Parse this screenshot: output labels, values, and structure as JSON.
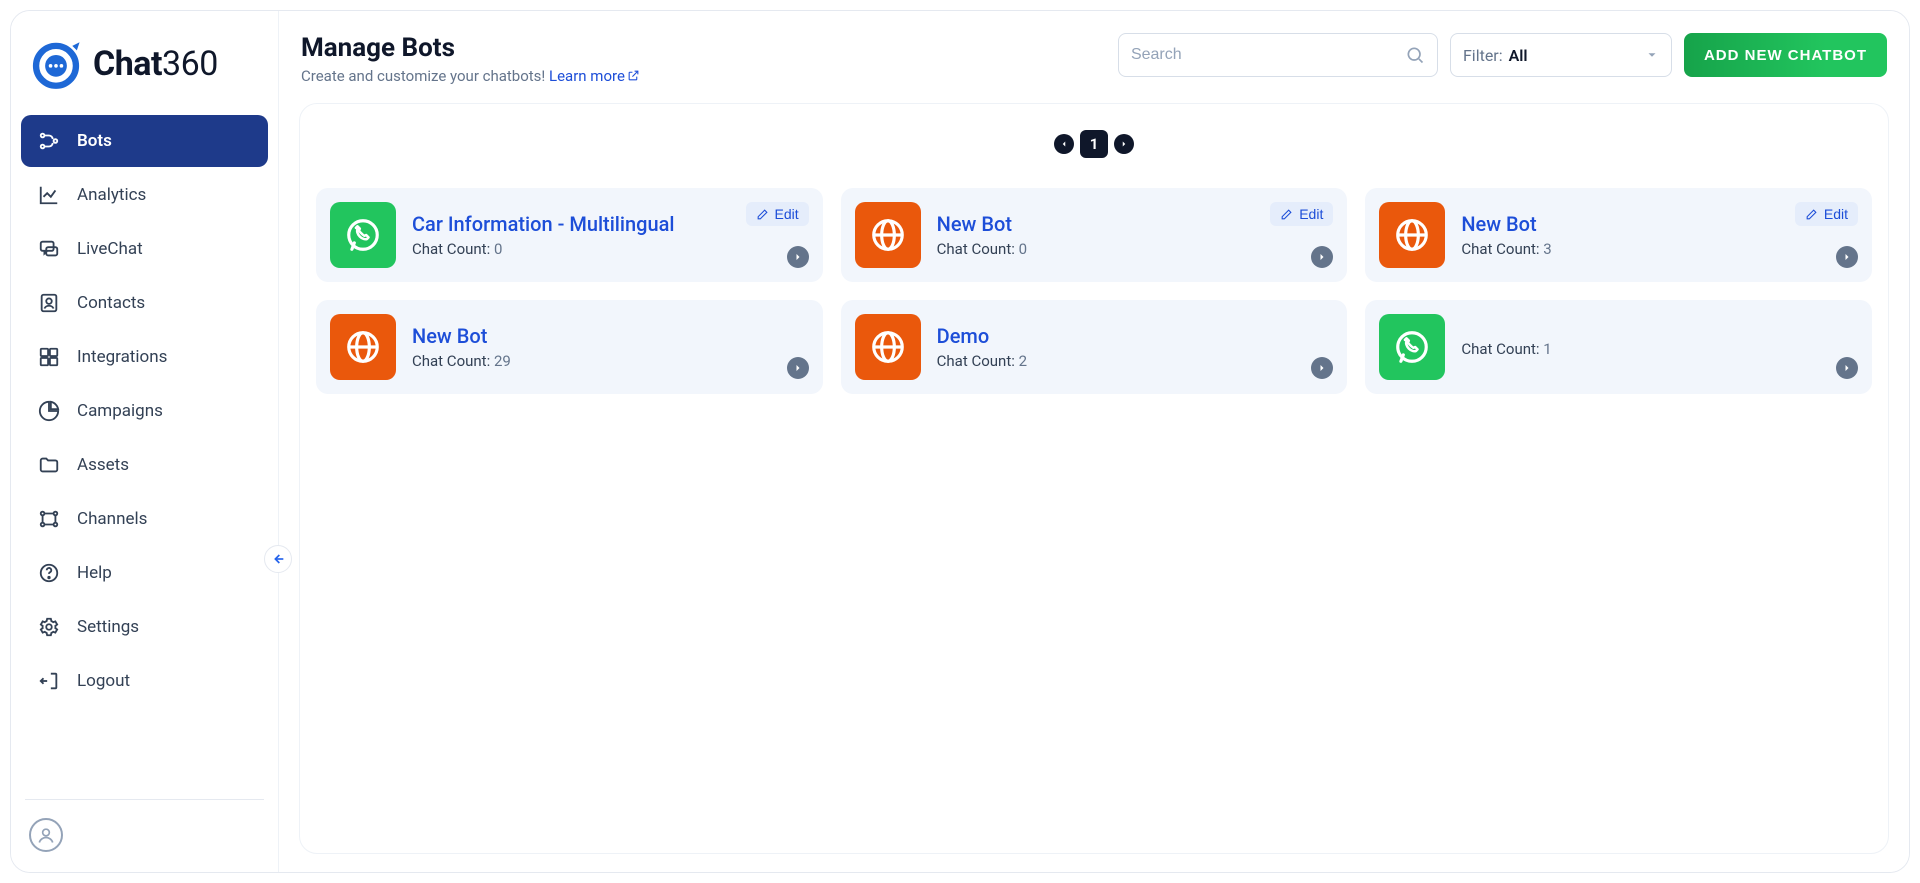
{
  "brand": {
    "name": "Chat",
    "suffix": "360"
  },
  "sidebar": {
    "items": [
      {
        "id": "bots",
        "label": "Bots",
        "active": true
      },
      {
        "id": "analytics",
        "label": "Analytics",
        "active": false
      },
      {
        "id": "livechat",
        "label": "LiveChat",
        "active": false
      },
      {
        "id": "contacts",
        "label": "Contacts",
        "active": false
      },
      {
        "id": "integrations",
        "label": "Integrations",
        "active": false
      },
      {
        "id": "campaigns",
        "label": "Campaigns",
        "active": false
      },
      {
        "id": "assets",
        "label": "Assets",
        "active": false
      },
      {
        "id": "channels",
        "label": "Channels",
        "active": false
      },
      {
        "id": "help",
        "label": "Help",
        "active": false
      },
      {
        "id": "settings",
        "label": "Settings",
        "active": false
      },
      {
        "id": "logout",
        "label": "Logout",
        "active": false
      }
    ]
  },
  "header": {
    "title": "Manage Bots",
    "subtitle_prefix": "Create and customize your chatbots! ",
    "learn_more": "Learn more",
    "search_placeholder": "Search",
    "filter_label": "Filter:",
    "filter_value": "All",
    "add_button": "ADD NEW CHATBOT"
  },
  "pager": {
    "current": "1"
  },
  "bots": [
    {
      "title": "Car Information - Multilingual",
      "count_label": "Chat Count:",
      "count": "0",
      "icon": "whatsapp",
      "color": "green",
      "edit": "Edit"
    },
    {
      "title": "New Bot",
      "count_label": "Chat Count:",
      "count": "0",
      "icon": "globe",
      "color": "orange",
      "edit": "Edit"
    },
    {
      "title": "New Bot",
      "count_label": "Chat Count:",
      "count": "3",
      "icon": "globe",
      "color": "orange",
      "edit": "Edit"
    },
    {
      "title": "New Bot",
      "count_label": "Chat Count:",
      "count": "29",
      "icon": "globe",
      "color": "orange",
      "edit": ""
    },
    {
      "title": "Demo",
      "count_label": "Chat Count:",
      "count": "2",
      "icon": "globe",
      "color": "orange",
      "edit": ""
    },
    {
      "title": "",
      "count_label": "Chat Count:",
      "count": "1",
      "icon": "whatsapp",
      "color": "green",
      "edit": ""
    }
  ]
}
